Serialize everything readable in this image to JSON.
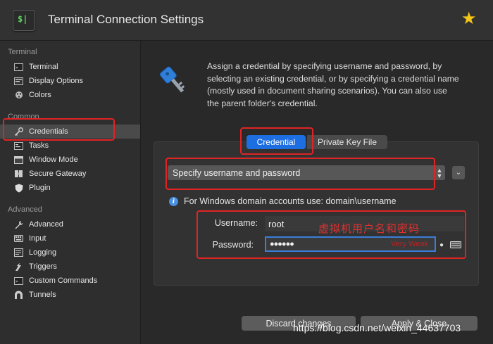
{
  "window": {
    "title": "Terminal Connection Settings",
    "app_icon_glyph": "$|"
  },
  "sidebar": {
    "sections": [
      {
        "header": "Terminal",
        "items": [
          {
            "label": "Terminal",
            "icon": "terminal-icon"
          },
          {
            "label": "Display Options",
            "icon": "display-icon"
          },
          {
            "label": "Colors",
            "icon": "colors-icon"
          }
        ]
      },
      {
        "header": "Common",
        "items": [
          {
            "label": "Credentials",
            "icon": "key-icon",
            "selected": true
          },
          {
            "label": "Tasks",
            "icon": "tasks-icon"
          },
          {
            "label": "Window Mode",
            "icon": "window-icon"
          },
          {
            "label": "Secure Gateway",
            "icon": "gateway-icon"
          },
          {
            "label": "Plugin",
            "icon": "plugin-icon"
          }
        ]
      },
      {
        "header": "Advanced",
        "items": [
          {
            "label": "Advanced",
            "icon": "wrench-icon"
          },
          {
            "label": "Input",
            "icon": "keyboard-icon"
          },
          {
            "label": "Logging",
            "icon": "logging-icon"
          },
          {
            "label": "Triggers",
            "icon": "triggers-icon"
          },
          {
            "label": "Custom Commands",
            "icon": "commands-icon"
          },
          {
            "label": "Tunnels",
            "icon": "tunnel-icon"
          }
        ]
      }
    ]
  },
  "main": {
    "description": "Assign a credential by specifying username and password, by selecting an existing credential, or by specifying a credential name (mostly used in document sharing scenarios). You can also use the parent folder's credential.",
    "tabs": [
      {
        "label": "Credential",
        "active": true
      },
      {
        "label": "Private Key File",
        "active": false
      }
    ],
    "credential_type": "Specify username and password",
    "info_text": "For Windows domain accounts use: domain\\username",
    "username_label": "Username:",
    "username_value": "root",
    "password_label": "Password:",
    "password_value": "●●●●●●",
    "password_strength": "Very Weak",
    "annotation": "虚拟机用户名和密码"
  },
  "footer": {
    "discard_label": "Discard changes",
    "apply_label": "Apply & Close"
  },
  "watermark": "https://blog.csdn.net/weixin_44637703",
  "colors": {
    "accent": "#1d6ee0",
    "highlight_box": "#e02424",
    "star": "#f5c518"
  }
}
